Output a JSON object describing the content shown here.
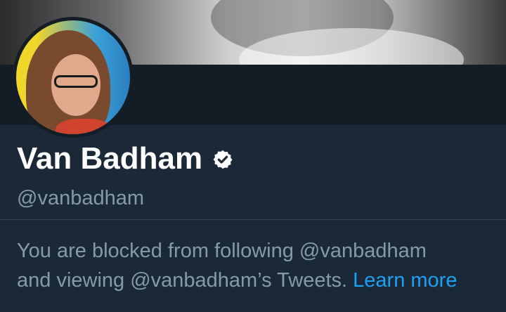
{
  "profile": {
    "name": "Van Badham",
    "handle": "@vanbadham",
    "verified_icon": "verified-badge-icon"
  },
  "notice": {
    "line1": "You are blocked from following @vanbadham",
    "line2": "and viewing @vanbadham’s Tweets.",
    "link_label": "Learn more"
  },
  "colors": {
    "background": "#1b2838",
    "band": "#141d26",
    "accent": "#1da1f2",
    "muted_text": "#8899a6"
  }
}
